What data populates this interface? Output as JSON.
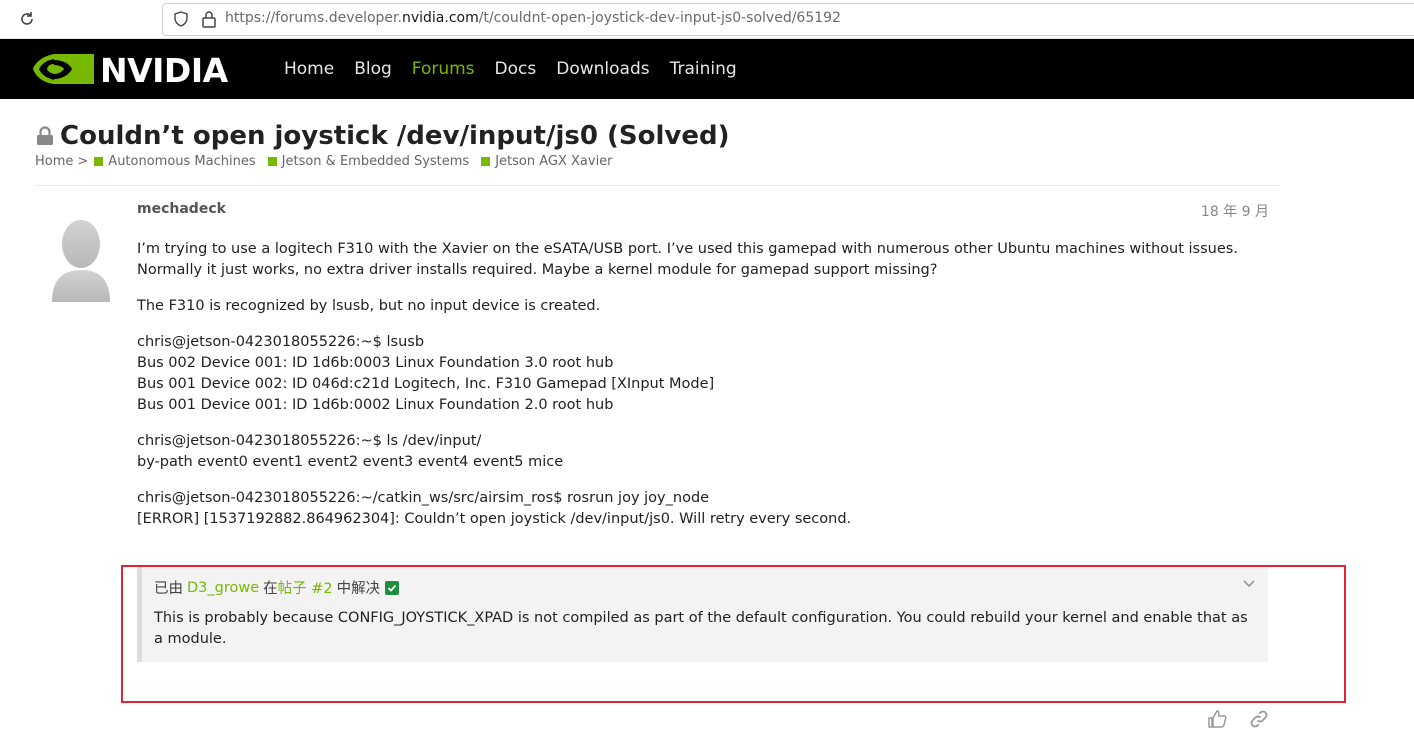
{
  "browser": {
    "url_prefix": "https://forums.developer.",
    "url_domain": "nvidia.com",
    "url_path": "/t/couldnt-open-joystick-dev-input-js0-solved/65192"
  },
  "header": {
    "nav": [
      "Home",
      "Blog",
      "Forums",
      "Docs",
      "Downloads",
      "Training"
    ],
    "active_nav": "Forums"
  },
  "topic": {
    "title": "Couldn’t open joystick /dev/input/js0 (Solved)",
    "breadcrumb_home": "Home",
    "breadcrumb_sep": ">",
    "categories": [
      "Autonomous Machines",
      "Jetson & Embedded Systems",
      "Jetson AGX Xavier"
    ]
  },
  "post": {
    "author": "mechadeck",
    "date": "18 年 9 月",
    "paragraphs": [
      "I’m trying to use a logitech F310 with the Xavier on the eSATA/USB port. I’ve used this gamepad with numerous other Ubuntu machines without issues. Normally it just works, no extra driver installs required. Maybe a kernel module for gamepad support missing?",
      "The F310 is recognized by lsusb, but no input device is created.",
      "chris@jetson-0423018055226:~$ lsusb\nBus 002 Device 001: ID 1d6b:0003 Linux Foundation 3.0 root hub\nBus 001 Device 002: ID 046d:c21d Logitech, Inc. F310 Gamepad [XInput Mode]\nBus 001 Device 001: ID 1d6b:0002 Linux Foundation 2.0 root hub",
      "chris@jetson-0423018055226:~$ ls /dev/input/\nby-path event0 event1 event2 event3 event4 event5 mice",
      "chris@jetson-0423018055226:~/catkin_ws/src/airsim_ros$ rosrun joy joy_node\n[ERROR] [1537192882.864962304]: Couldn’t open joystick /dev/input/js0. Will retry every second."
    ]
  },
  "solution": {
    "prefix": "已由",
    "solver": "D3_growe",
    "mid": "在",
    "post_link": "帖子 #2",
    "suffix": "中解决",
    "text": "This is probably because CONFIG_JOYSTICK_XPAD is not compiled as part of the default configuration. You could rebuild your kernel and enable that as a module."
  },
  "icons": {
    "reload": "reload-icon",
    "shield": "shield-icon",
    "lock": "lock-icon",
    "like": "like-icon",
    "link": "link-icon",
    "chevron": "chevron-down-icon",
    "check": "check-icon"
  },
  "colors": {
    "brand_green": "#76b900",
    "highlight_red": "#e0262e",
    "check_green": "#1e8e3e"
  }
}
